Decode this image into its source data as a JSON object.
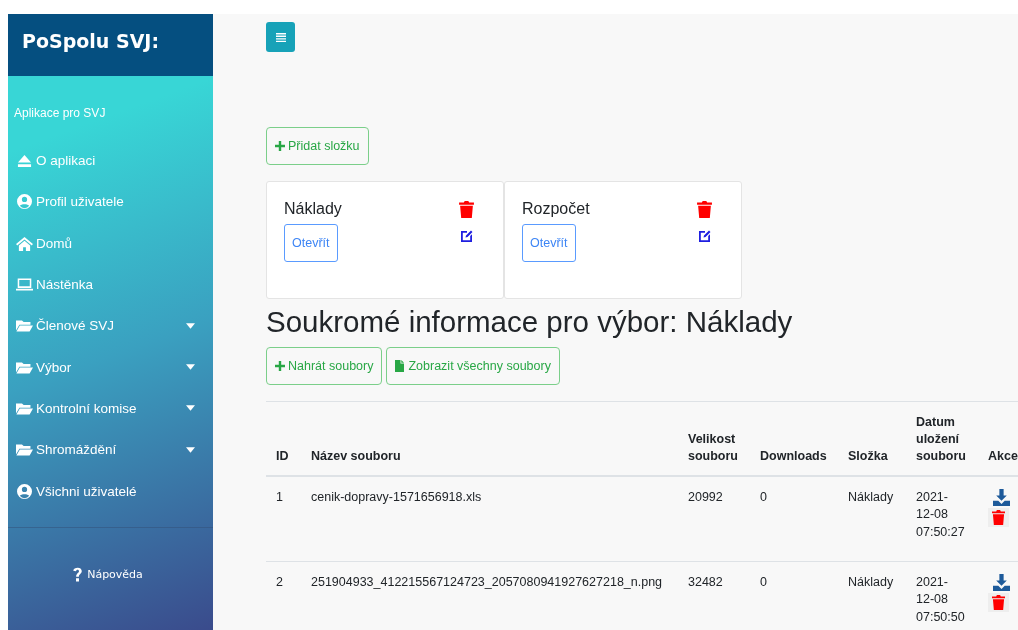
{
  "sidebar": {
    "brand": "PoSpolu SVJ:",
    "subtitle": "Aplikace pro SVJ",
    "items": [
      {
        "label": "O aplikaci",
        "kind": "eject",
        "dropdown": false
      },
      {
        "label": "Profil uživatele",
        "kind": "user",
        "dropdown": false
      },
      {
        "label": "Domů",
        "kind": "home",
        "dropdown": false
      },
      {
        "label": "Nástěnka",
        "kind": "laptop",
        "dropdown": false
      },
      {
        "label": "Členové SVJ",
        "kind": "folder",
        "dropdown": true
      },
      {
        "label": "Výbor",
        "kind": "folder",
        "dropdown": true
      },
      {
        "label": "Kontrolní komise",
        "kind": "folder",
        "dropdown": true
      },
      {
        "label": "Shromáždění",
        "kind": "folder",
        "dropdown": true
      },
      {
        "label": "Všichni uživatelé",
        "kind": "user",
        "dropdown": false
      }
    ],
    "help": "Nápověda"
  },
  "add_folder_button": "Přidat složku",
  "folders": [
    {
      "name": "Náklady",
      "open_button": "Otevřít"
    },
    {
      "name": "Rozpočet",
      "open_button": "Otevřít"
    }
  ],
  "heading": "Soukromé informace pro výbor: Náklady",
  "upload_button": "Nahrát soubory",
  "show_all_button": "Zobrazit všechny soubory",
  "table": {
    "columns": [
      "ID",
      "Název souboru",
      "Velikost souboru",
      "Downloads",
      "Složka",
      "Datum uložení souboru",
      "Akce"
    ],
    "rows": [
      {
        "id": "1",
        "name": "cenik-dopravy-1571656918.xls",
        "size": "20992",
        "downloads": "0",
        "folder": "Náklady",
        "date": "2021- 12-08 07:50:27"
      },
      {
        "id": "2",
        "name": "251904933_412215567124723_2057080941927627218_n.png",
        "size": "32482",
        "downloads": "0",
        "folder": "Náklady",
        "date": "2021- 12-08 07:50:50"
      }
    ]
  }
}
